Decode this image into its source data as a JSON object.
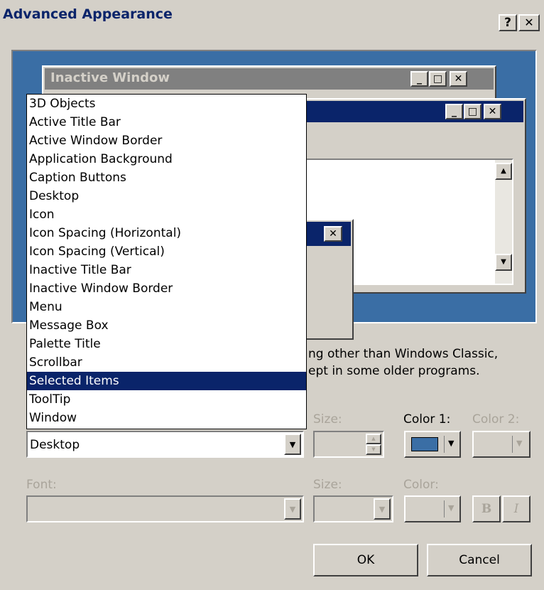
{
  "dialog": {
    "title": "Advanced Appearance",
    "help_glyph": "?",
    "close_glyph": "✕"
  },
  "preview": {
    "inactive_title": "Inactive Window",
    "min_glyph": "_",
    "max_glyph": "□",
    "close_glyph": "✕",
    "scroll_up": "▲",
    "scroll_down": "▼"
  },
  "item_list": [
    "3D Objects",
    "Active Title Bar",
    "Active Window Border",
    "Application Background",
    "Caption Buttons",
    "Desktop",
    "Icon",
    "Icon Spacing (Horizontal)",
    "Icon Spacing (Vertical)",
    "Inactive Title Bar",
    "Inactive Window Border",
    "Menu",
    "Message Box",
    "Palette Title",
    "Scrollbar",
    "Selected Items",
    "ToolTip",
    "Window"
  ],
  "selected_list_item": "Selected Items",
  "info_text": {
    "line1": "ng other than Windows Classic,",
    "line2": "ept in some older programs."
  },
  "item_row": {
    "item_value": "Desktop",
    "size_label": "Size:",
    "color1_label": "Color 1:",
    "color2_label": "Color 2:",
    "color1_value": "#3a6ea5"
  },
  "font_row": {
    "font_label": "Font:",
    "size_label": "Size:",
    "color_label": "Color:",
    "bold_label": "B",
    "italic_label": "I"
  },
  "buttons": {
    "ok": "OK",
    "cancel": "Cancel"
  },
  "colors": {
    "desktop_blue": "#3a6ea5",
    "selection_navy": "#0a246a",
    "face": "#d4d0c8"
  }
}
